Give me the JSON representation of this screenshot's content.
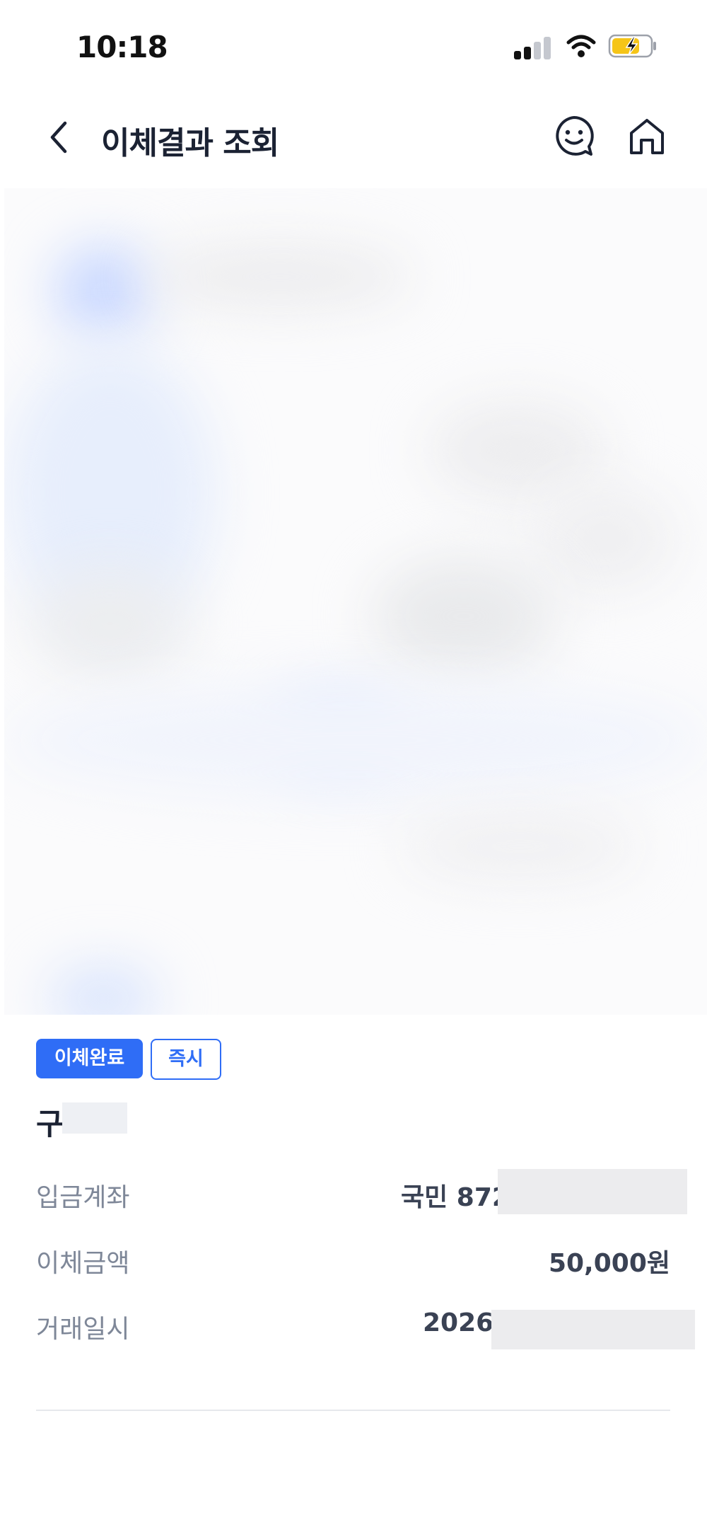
{
  "status_bar": {
    "time": "10:18"
  },
  "header": {
    "title": "이체결과 조회"
  },
  "result": {
    "badges": {
      "status": "이체완료",
      "type": "즉시"
    },
    "recipient_initial": "구",
    "rows": [
      {
        "label": "입금계좌",
        "value": "국민 872"
      },
      {
        "label": "이체금액",
        "value": "50,000원"
      },
      {
        "label": "거래일시",
        "value": "2026."
      }
    ]
  },
  "colors": {
    "accent": "#2f6df6",
    "label": "#7e8798",
    "value": "#3a4254"
  }
}
